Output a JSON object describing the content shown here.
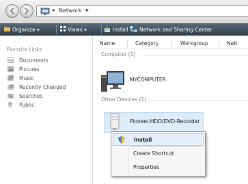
{
  "address_bar": {
    "location": "Network",
    "separator": "▸"
  },
  "toolbar": {
    "organize": "Organize ▾",
    "views": "Views ▾",
    "install": "Install",
    "network_center": "Network and Sharing Center"
  },
  "sidebar": {
    "title": "Favorite Links",
    "items": [
      {
        "label": "Documents",
        "icon": "documents-icon"
      },
      {
        "label": "Pictures",
        "icon": "pictures-icon"
      },
      {
        "label": "Music",
        "icon": "music-icon"
      },
      {
        "label": "Recently Changed",
        "icon": "recently-changed-icon"
      },
      {
        "label": "Searches",
        "icon": "searches-icon"
      },
      {
        "label": "Public",
        "icon": "public-icon"
      }
    ]
  },
  "columns": [
    "Name",
    "Category",
    "Workgroup",
    "Neti"
  ],
  "groups": {
    "computer": {
      "header": "Computer (1)",
      "items": [
        "MYCOMPUTER"
      ]
    },
    "other": {
      "header": "Other Devices (1)",
      "items": [
        "Pioneer.HDD/DVD-Recorder"
      ]
    }
  },
  "context_menu": {
    "items": [
      {
        "label": "Install",
        "highlighted": true
      },
      {
        "label": "Create Shortcut"
      },
      {
        "label": "Properties"
      }
    ]
  },
  "colors": {
    "toolbar_bg": "#3c4a58",
    "selection_bg": "#dcecf9",
    "menu_highlight": "#e3eefa"
  }
}
